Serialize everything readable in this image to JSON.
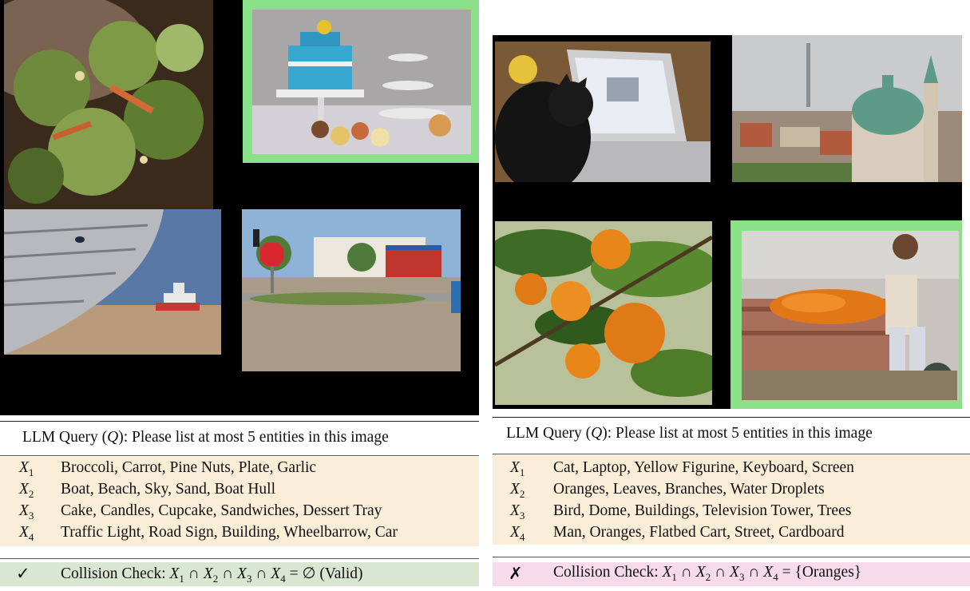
{
  "left": {
    "images": [
      {
        "name": "broccoli-photo",
        "subject": "broccoli salad on plate",
        "highlighted": false
      },
      {
        "name": "cake-photo",
        "subject": "cake and dessert tray",
        "highlighted": true
      },
      {
        "name": "boat-photo",
        "subject": "boat hull and beach",
        "highlighted": false
      },
      {
        "name": "street-photo",
        "subject": "traffic light and stop sign",
        "highlighted": false
      }
    ],
    "query_prefix": "LLM Query (",
    "query_var": "Q",
    "query_suffix": "): Please list at most 5 entities in this image",
    "rows": [
      {
        "var": "X",
        "sub": "1",
        "entities": "Broccoli, Carrot, Pine Nuts, Plate, Garlic"
      },
      {
        "var": "X",
        "sub": "2",
        "entities": "Boat, Beach, Sky, Sand, Boat Hull"
      },
      {
        "var": "X",
        "sub": "3",
        "entities": "Cake, Candles, Cupcake, Sandwiches, Dessert Tray"
      },
      {
        "var": "X",
        "sub": "4",
        "entities": "Traffic Light, Road Sign, Building, Wheelbarrow, Car"
      }
    ],
    "check": {
      "mark": "✓",
      "label": "Collision Check: ",
      "result": " = ∅ (Valid)",
      "status": "valid",
      "color": "#d9e6d2"
    }
  },
  "right": {
    "images": [
      {
        "name": "cat-laptop-photo",
        "subject": "cat with laptop",
        "highlighted": false
      },
      {
        "name": "city-dome-photo",
        "subject": "domes and television tower",
        "highlighted": false
      },
      {
        "name": "oranges-tree-photo",
        "subject": "oranges on branches",
        "highlighted": false
      },
      {
        "name": "orange-cart-photo",
        "subject": "man with orange cart",
        "highlighted": true
      }
    ],
    "query_prefix": "LLM Query (",
    "query_var": "Q",
    "query_suffix": "): Please list at most 5 entities in this image",
    "rows": [
      {
        "var": "X",
        "sub": "1",
        "entities": "Cat, Laptop, Yellow Figurine, Keyboard, Screen"
      },
      {
        "var": "X",
        "sub": "2",
        "entities": "Oranges, Leaves, Branches, Water Droplets"
      },
      {
        "var": "X",
        "sub": "3",
        "entities": "Bird, Dome, Buildings, Television Tower, Trees"
      },
      {
        "var": "X",
        "sub": "4",
        "entities": "Man, Oranges, Flatbed Cart, Street, Cardboard"
      }
    ],
    "check": {
      "mark": "✗",
      "label": "Collision Check: ",
      "result": " = {Oranges}",
      "status": "invalid",
      "color": "#f7dbe8"
    }
  },
  "colors": {
    "highlight_frame": "#8be08a",
    "row_background": "#fbeed9",
    "mosaic_background": "#000000"
  }
}
